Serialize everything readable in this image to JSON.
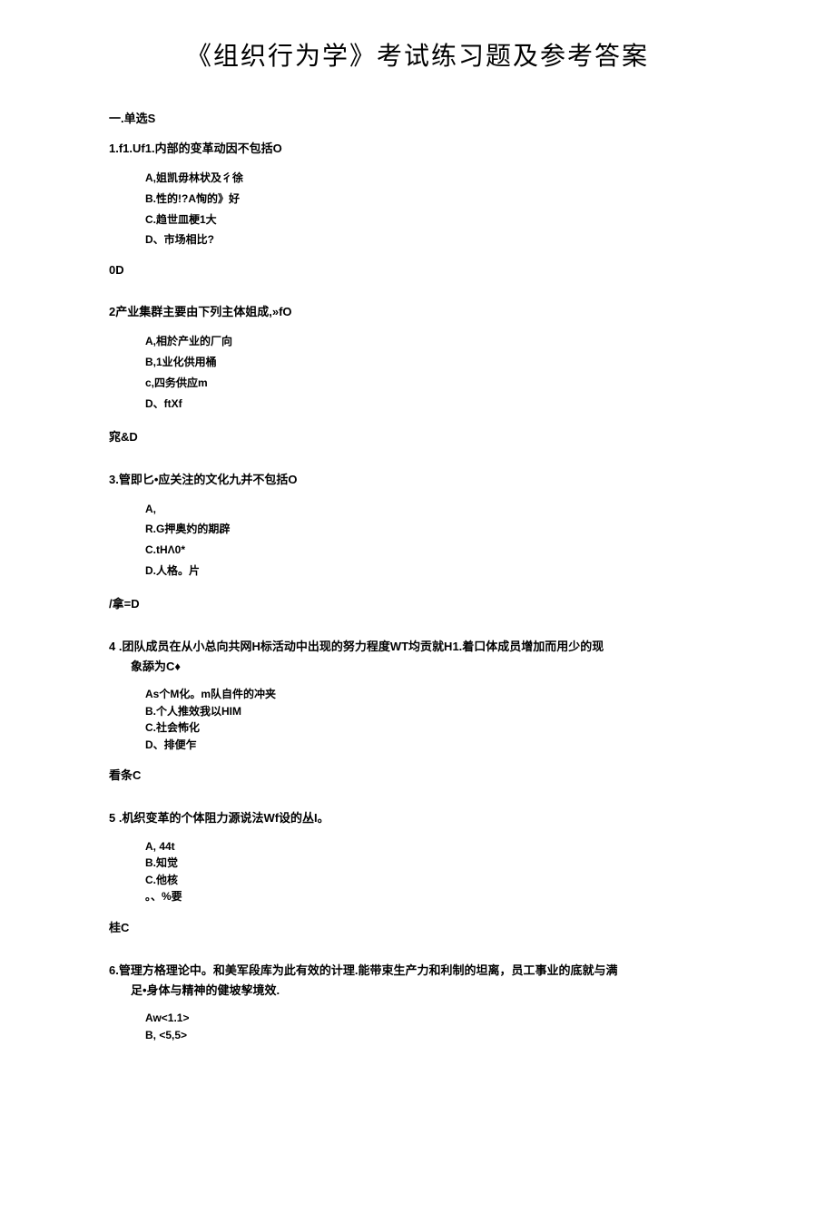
{
  "title": "《组织行为学》考试练习题及参考答案",
  "section": "一.单选S",
  "questions": [
    {
      "stem": "1.f1.Uf1.内部的变革动因不包括O",
      "opts": [
        "A,姐凯毋林状及彳徐",
        "B.性的!?A恂的》好",
        "C.趋世皿梗1大",
        "D、市场相比?"
      ],
      "ans": "0D"
    },
    {
      "stem": "2产业集群主要由下列主体姐成,»fO",
      "opts": [
        "A,相於产业的厂向",
        "B,1业化供用桶",
        "c,四务供应m",
        "D、ftXf"
      ],
      "ans": "窕&D"
    },
    {
      "stem": "3.管即匕•应关注的文化九并不包括O",
      "opts": [
        "A,",
        "R.G押奥妁的期辟",
        "C.tHΛ0*",
        "D.人格。片"
      ],
      "ans": "/拿=D"
    },
    {
      "stem": "4 .团队成员在从小总向共网H标活动中出现的努力程度WT均贡就H1.着口体成员增加而用少的现",
      "stem2": "象舔为C♦",
      "opts": [
        "As个M化。m队自件的冲夹",
        "B.个人推效我以HIM",
        "C.社会怖化",
        "D、排便乍"
      ],
      "ans": "看条C",
      "tight": true
    },
    {
      "stem": "5 .机织变革的个体阻力源说法Wf设的丛I。",
      "opts": [
        "A,    44t",
        "B.知觉",
        "C.他核",
        "。、%要"
      ],
      "ans": "桂C",
      "tight": true
    },
    {
      "stem": "6.管理方格理论中。和美军段库为此有效的计理.能带束生产力和利制的坦离，员工事业的底就与满",
      "stem2": "足•身体与精神的健坡孧境效.",
      "opts": [
        "Aw<1.1>",
        "B,   <5,5>"
      ],
      "ans": "",
      "tight": true
    }
  ]
}
